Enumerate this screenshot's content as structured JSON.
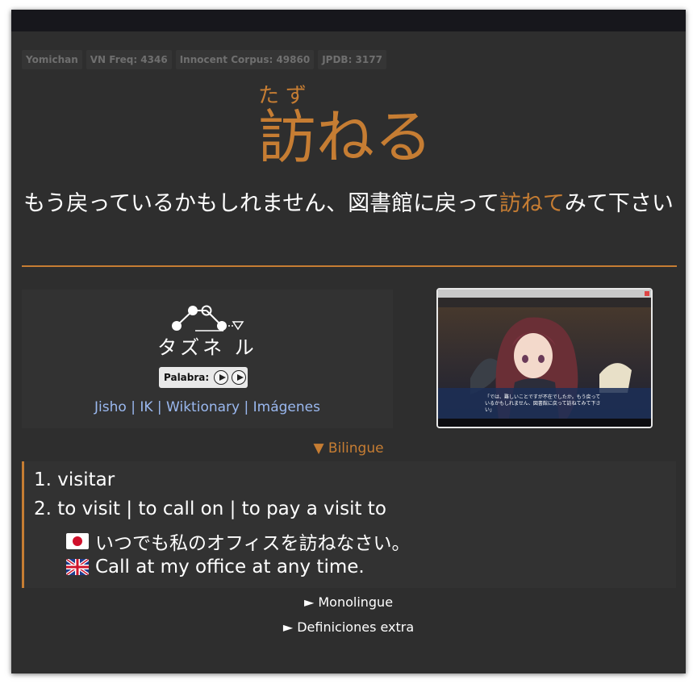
{
  "tags": [
    {
      "label": "Yomichan"
    },
    {
      "label": "VN Freq: 4346"
    },
    {
      "label": "Innocent Corpus: 49860"
    },
    {
      "label": "JPDB: 3177"
    }
  ],
  "word": {
    "reading": "たず",
    "headword": "訪ねる"
  },
  "sentence": {
    "before": "もう戻っているかもしれません、図書館に戻って",
    "highlight": "訪ねて",
    "after": "みて下さい"
  },
  "pitch": {
    "kana": "タズネ ル",
    "audio_label": "Palabra:"
  },
  "links": {
    "jisho": "Jisho",
    "ik": "IK",
    "wiktionary": "Wiktionary",
    "images": "Imágenes",
    "separator": "|"
  },
  "screenshot": {
    "subtitle_line1": "「では、難しいことですが不在でしたか。もう戻って",
    "subtitle_line2": "いるかもしれません、図書館に戻って訪ねてみて下さ",
    "subtitle_line3": "い」"
  },
  "sections": {
    "bilingue": "▼ Bilingue",
    "monolingue": "► Monolingue",
    "extra": "► Definiciones extra"
  },
  "definitions": {
    "def1": "1. visitar",
    "def2": "2. to visit | to call on | to pay a visit to",
    "example_jp": "いつでも私のオフィスを訪ねなさい。",
    "example_en": "Call at my office at any time."
  },
  "colors": {
    "accent": "#c67d33",
    "background": "#2e2e2e",
    "link": "#9ab8ef"
  }
}
